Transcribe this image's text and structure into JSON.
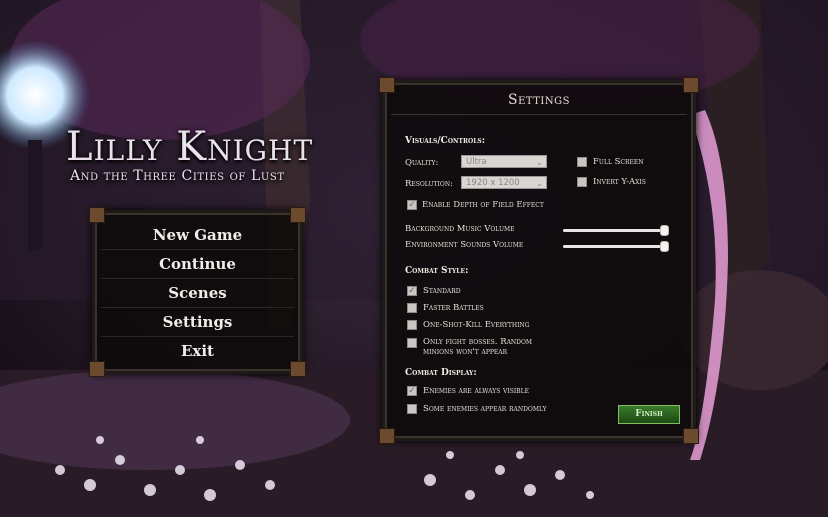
{
  "game": {
    "title": "Lilly Knight",
    "subtitle": "And the Three Cities of Lust"
  },
  "main_menu": {
    "items": [
      "New Game",
      "Continue",
      "Scenes",
      "Settings",
      "Exit"
    ]
  },
  "settings": {
    "title": "Settings",
    "visuals_heading": "Visuals/Controls:",
    "quality_label": "Quality:",
    "quality_value": "Ultra",
    "resolution_label": "Resolution:",
    "resolution_value": "1920 x 1200",
    "full_screen_label": "Full Screen",
    "full_screen_checked": false,
    "invert_y_label": "Invert Y-Axis",
    "invert_y_checked": false,
    "dof_label": "Enable Depth of Field Effect",
    "dof_checked": true,
    "bg_music_label": "Background Music Volume",
    "bg_music_level": 1.0,
    "env_sounds_label": "Environment Sounds Volume",
    "env_sounds_level": 1.0,
    "combat_style_heading": "Combat Style:",
    "combat_style_options": [
      {
        "label": "Standard",
        "checked": true
      },
      {
        "label": "Faster Battles",
        "checked": false
      },
      {
        "label": "One-Shot-Kill Everything",
        "checked": false
      },
      {
        "label": "Only fight bosses. Random minions won't appear",
        "checked": false
      }
    ],
    "combat_display_heading": "Combat Display:",
    "combat_display_options": [
      {
        "label": "Enemies are always visible",
        "checked": true
      },
      {
        "label": "Some enemies appear randomly",
        "checked": false
      }
    ],
    "finish_label": "Finish"
  }
}
